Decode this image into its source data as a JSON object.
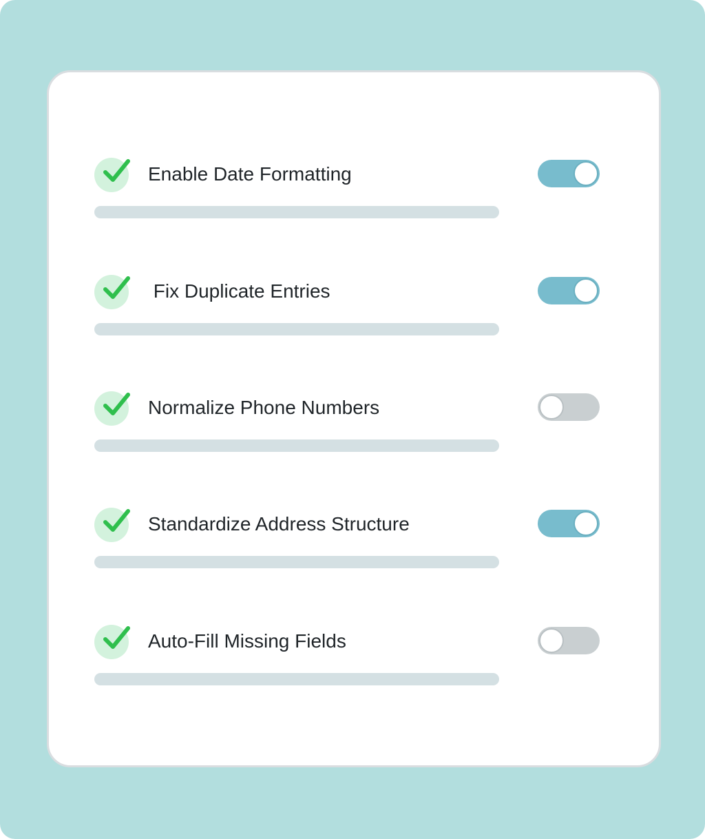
{
  "settings": [
    {
      "label": "Enable Date Formatting",
      "enabled": true
    },
    {
      "label": " Fix Duplicate Entries",
      "enabled": true
    },
    {
      "label": "Normalize Phone Numbers",
      "enabled": false
    },
    {
      "label": "Standardize Address Structure",
      "enabled": true
    },
    {
      "label": "Auto-Fill Missing Fields",
      "enabled": false
    }
  ],
  "icons": {
    "check": "checkmark-icon"
  },
  "colors": {
    "background": "#b2dede",
    "card": "#ffffff",
    "toggle_on": "#78bccd",
    "toggle_off": "#c9cfd1",
    "check": "#2fbf4d",
    "check_bg": "#d3f2dd",
    "placeholder_bar": "#d4e0e3"
  }
}
